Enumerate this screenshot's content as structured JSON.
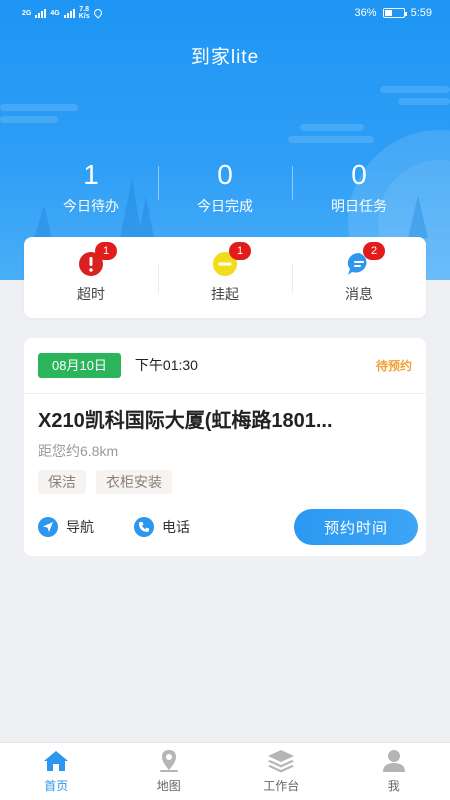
{
  "status_bar": {
    "network_left": "2G",
    "network_right": "4G",
    "speed_value": "7.8",
    "speed_unit": "K/s",
    "battery": "36%",
    "time": "5:59"
  },
  "header": {
    "title": "到家lite"
  },
  "stats": [
    {
      "value": "1",
      "label": "今日待办"
    },
    {
      "value": "0",
      "label": "今日完成"
    },
    {
      "value": "0",
      "label": "明日任务"
    }
  ],
  "quick": [
    {
      "label": "超时",
      "badge": "1",
      "icon": "alert-icon",
      "color": "#d9221f"
    },
    {
      "label": "挂起",
      "badge": "1",
      "icon": "pause-icon",
      "color": "#f3dc1a"
    },
    {
      "label": "消息",
      "badge": "2",
      "icon": "message-icon",
      "color": "#2d96ee"
    }
  ],
  "order": {
    "date": "08月10日",
    "time": "下午01:30",
    "status": "待预约",
    "address": "X210凯科国际大厦(虹梅路1801...",
    "distance": "距您约6.8km",
    "tags": [
      "保洁",
      "衣柜安装"
    ],
    "nav_label": "导航",
    "phone_label": "电话",
    "book_label": "预约时间"
  },
  "tabbar": [
    {
      "label": "首页",
      "icon": "home-icon",
      "active": true
    },
    {
      "label": "地图",
      "icon": "map-pin-icon",
      "active": false
    },
    {
      "label": "工作台",
      "icon": "layers-icon",
      "active": false
    },
    {
      "label": "我",
      "icon": "user-icon",
      "active": false
    }
  ],
  "colors": {
    "primary": "#2d96ee",
    "date_tag": "#2ab55a",
    "pending": "#f0a238",
    "badge": "#e31b1b"
  }
}
